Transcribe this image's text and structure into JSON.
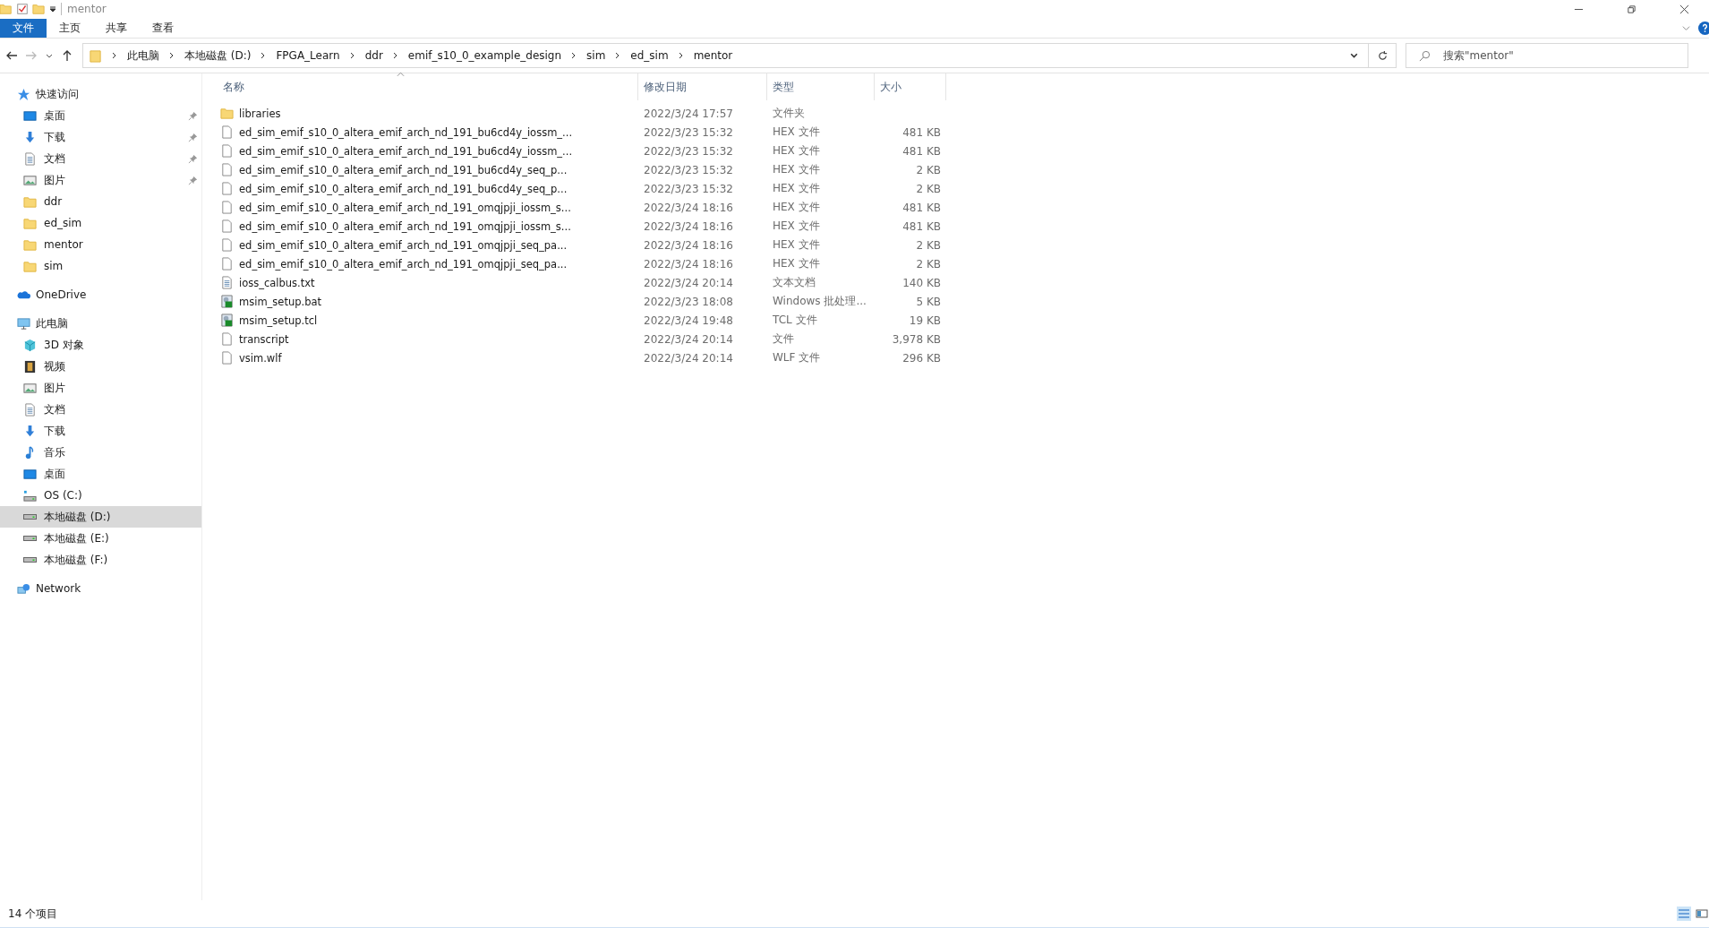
{
  "window": {
    "title": "mentor"
  },
  "ribbon_tabs": [
    {
      "label": "文件",
      "selected": true
    },
    {
      "label": "主页",
      "selected": false
    },
    {
      "label": "共享",
      "selected": false
    },
    {
      "label": "查看",
      "selected": false
    }
  ],
  "breadcrumb": [
    "此电脑",
    "本地磁盘 (D:)",
    "FPGA_Learn",
    "ddr",
    "emif_s10_0_example_design",
    "sim",
    "ed_sim",
    "mentor"
  ],
  "search": {
    "placeholder": "搜索\"mentor\""
  },
  "sidebar": [
    {
      "label": "快速访问",
      "kind": "star",
      "children": [
        {
          "label": "桌面",
          "kind": "desktop",
          "pinned": true,
          "selected": false
        },
        {
          "label": "下载",
          "kind": "download",
          "pinned": true,
          "selected": false
        },
        {
          "label": "文档",
          "kind": "doc",
          "pinned": true,
          "selected": false
        },
        {
          "label": "图片",
          "kind": "image",
          "pinned": true,
          "selected": false
        },
        {
          "label": "ddr",
          "kind": "folder",
          "pinned": false,
          "selected": false
        },
        {
          "label": "ed_sim",
          "kind": "folder",
          "pinned": false,
          "selected": false
        },
        {
          "label": "mentor",
          "kind": "folder",
          "pinned": false,
          "selected": false
        },
        {
          "label": "sim",
          "kind": "folder",
          "pinned": false,
          "selected": false
        }
      ]
    },
    {
      "label": "OneDrive",
      "kind": "cloud"
    },
    {
      "label": "此电脑",
      "kind": "pc",
      "children": [
        {
          "label": "3D 对象",
          "kind": "cube",
          "pinned": false,
          "selected": false
        },
        {
          "label": "视频",
          "kind": "video",
          "pinned": false,
          "selected": false
        },
        {
          "label": "图片",
          "kind": "image",
          "pinned": false,
          "selected": false
        },
        {
          "label": "文档",
          "kind": "doc",
          "pinned": false,
          "selected": false
        },
        {
          "label": "下载",
          "kind": "download",
          "pinned": false,
          "selected": false
        },
        {
          "label": "音乐",
          "kind": "music",
          "pinned": false,
          "selected": false
        },
        {
          "label": "桌面",
          "kind": "desktop",
          "pinned": false,
          "selected": false
        },
        {
          "label": "OS (C:)",
          "kind": "osdrive",
          "pinned": false,
          "selected": false
        },
        {
          "label": "本地磁盘 (D:)",
          "kind": "drive",
          "pinned": false,
          "selected": true
        },
        {
          "label": "本地磁盘 (E:)",
          "kind": "drive",
          "pinned": false,
          "selected": false
        },
        {
          "label": "本地磁盘 (F:)",
          "kind": "drive",
          "pinned": false,
          "selected": false
        }
      ]
    },
    {
      "label": "Network",
      "kind": "network"
    }
  ],
  "table": {
    "columns": [
      "名称",
      "修改日期",
      "类型",
      "大小"
    ],
    "rows": [
      {
        "kind": "folder",
        "name": "libraries",
        "date": "2022/3/24 17:57",
        "type": "文件夹",
        "size": ""
      },
      {
        "kind": "file",
        "name": "ed_sim_emif_s10_0_altera_emif_arch_nd_191_bu6cd4y_iossm_...",
        "date": "2022/3/23 15:32",
        "type": "HEX 文件",
        "size": "481 KB"
      },
      {
        "kind": "file",
        "name": "ed_sim_emif_s10_0_altera_emif_arch_nd_191_bu6cd4y_iossm_...",
        "date": "2022/3/23 15:32",
        "type": "HEX 文件",
        "size": "481 KB"
      },
      {
        "kind": "file",
        "name": "ed_sim_emif_s10_0_altera_emif_arch_nd_191_bu6cd4y_seq_p...",
        "date": "2022/3/23 15:32",
        "type": "HEX 文件",
        "size": "2 KB"
      },
      {
        "kind": "file",
        "name": "ed_sim_emif_s10_0_altera_emif_arch_nd_191_bu6cd4y_seq_p...",
        "date": "2022/3/23 15:32",
        "type": "HEX 文件",
        "size": "2 KB"
      },
      {
        "kind": "file",
        "name": "ed_sim_emif_s10_0_altera_emif_arch_nd_191_omqjpji_iossm_s...",
        "date": "2022/3/24 18:16",
        "type": "HEX 文件",
        "size": "481 KB"
      },
      {
        "kind": "file",
        "name": "ed_sim_emif_s10_0_altera_emif_arch_nd_191_omqjpji_iossm_s...",
        "date": "2022/3/24 18:16",
        "type": "HEX 文件",
        "size": "481 KB"
      },
      {
        "kind": "file",
        "name": "ed_sim_emif_s10_0_altera_emif_arch_nd_191_omqjpji_seq_pa...",
        "date": "2022/3/24 18:16",
        "type": "HEX 文件",
        "size": "2 KB"
      },
      {
        "kind": "file",
        "name": "ed_sim_emif_s10_0_altera_emif_arch_nd_191_omqjpji_seq_pa...",
        "date": "2022/3/24 18:16",
        "type": "HEX 文件",
        "size": "2 KB"
      },
      {
        "kind": "text",
        "name": "ioss_calbus.txt",
        "date": "2022/3/24 20:14",
        "type": "文本文档",
        "size": "140 KB"
      },
      {
        "kind": "script",
        "name": "msim_setup.bat",
        "date": "2022/3/23 18:08",
        "type": "Windows 批处理...",
        "size": "5 KB"
      },
      {
        "kind": "script",
        "name": "msim_setup.tcl",
        "date": "2022/3/24 19:48",
        "type": "TCL 文件",
        "size": "19 KB"
      },
      {
        "kind": "file",
        "name": "transcript",
        "date": "2022/3/24 20:14",
        "type": "文件",
        "size": "3,978 KB"
      },
      {
        "kind": "file",
        "name": "vsim.wlf",
        "date": "2022/3/24 20:14",
        "type": "WLF 文件",
        "size": "296 KB"
      }
    ]
  },
  "status_bar": {
    "count": "14 个项目"
  }
}
